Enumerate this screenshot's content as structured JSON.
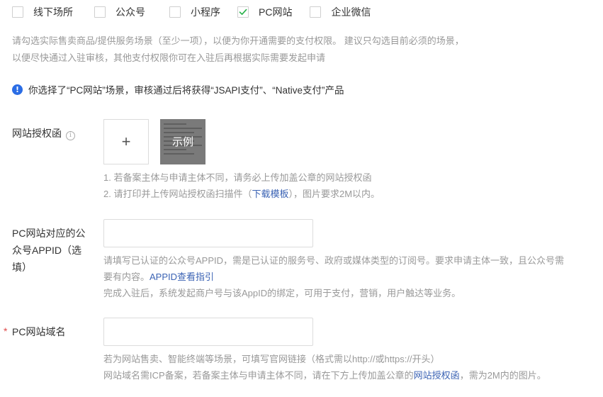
{
  "scenes": [
    {
      "label": "线下场所",
      "checked": false
    },
    {
      "label": "公众号",
      "checked": false
    },
    {
      "label": "小程序",
      "checked": false
    },
    {
      "label": "PC网站",
      "checked": true
    },
    {
      "label": "企业微信",
      "checked": false
    }
  ],
  "colors": {
    "check": "#2bb24c",
    "info": "#2b6de5",
    "link": "#3b63b4",
    "required": "#e04b4b"
  },
  "description": {
    "line1": "请勾选实际售卖商品/提供服务场景（至少一项），以便为你开通需要的支付权限。 建议只勾选目前必须的场景，",
    "line2": "以便尽快通过入驻审核，其他支付权限你可在入驻后再根据实际需要发起申请"
  },
  "notice": {
    "text": "你选择了“PC网站”场景，审核通过后将获得“JSAPI支付”、“Native支付”产品"
  },
  "auth_letter": {
    "label": "网站授权函",
    "upload_symbol": "+",
    "sample_label": "示例",
    "help1": "1. 若备案主体与申请主体不同，请务必上传加盖公章的网站授权函",
    "help2_prefix": "2. 请打印并上传网站授权函扫描件（",
    "help2_link": "下载模板",
    "help2_suffix": "），图片要求2M以内。"
  },
  "appid": {
    "label_line1": "PC网站对应的公",
    "label_line2": "众号APPID（选",
    "label_line3": "填）",
    "value": "",
    "help1": "请填写已认证的公众号APPID，需是已认证的服务号、政府或媒体类型的订阅号。要求申请主体一致，且公众号需",
    "help2_prefix": "要有内容。",
    "help2_link": "APPID查看指引",
    "help3": "完成入驻后，系统发起商户号与该AppID的绑定，可用于支付，营销，用户触达等业务。"
  },
  "domain": {
    "required_mark": "*",
    "label": "PC网站域名",
    "value": "",
    "help1": "若为网站售卖、智能终端等场景，可填写官网链接（格式需以http://或https://开头）",
    "help2_prefix": "网站域名需ICP备案，若备案主体与申请主体不同，请在下方上传加盖公章的",
    "help2_link": "网站授权函",
    "help2_suffix": "，需为2M内的图片。"
  }
}
